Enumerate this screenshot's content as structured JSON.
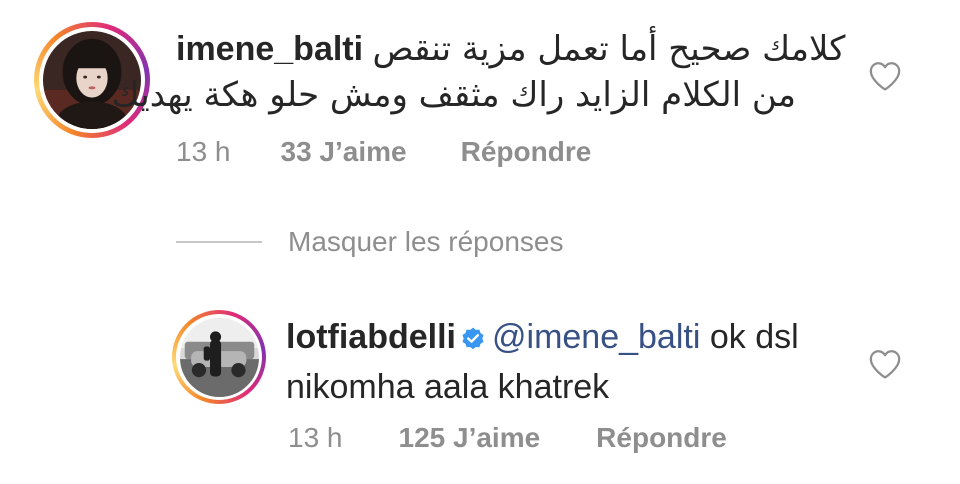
{
  "comment": {
    "username": "imene_balti",
    "text_line1": "كلامك صحيح أما تعمل مزية تنقص",
    "text_line2": "من الكلام الزايد راك مثقف ومش حلو هكة يهديك",
    "time": "13 h",
    "likes": "33 J’aime",
    "reply_label": "Répondre",
    "like_icon": "heart-outline-icon"
  },
  "hide_replies": {
    "label": "Masquer les réponses"
  },
  "reply": {
    "username": "lotfiabdelli",
    "verified": true,
    "verified_icon": "verified-badge-icon",
    "mention": "@imene_balti",
    "text": " ok dsl nikomha aala khatrek",
    "time": "13 h",
    "likes": "125 J’aime",
    "reply_label": "Répondre",
    "like_icon": "heart-outline-icon"
  },
  "colors": {
    "text": "#262626",
    "secondary": "#8e8e8e",
    "mention": "#385185",
    "verified": "#3897f0",
    "divider": "#c7c7c7"
  }
}
